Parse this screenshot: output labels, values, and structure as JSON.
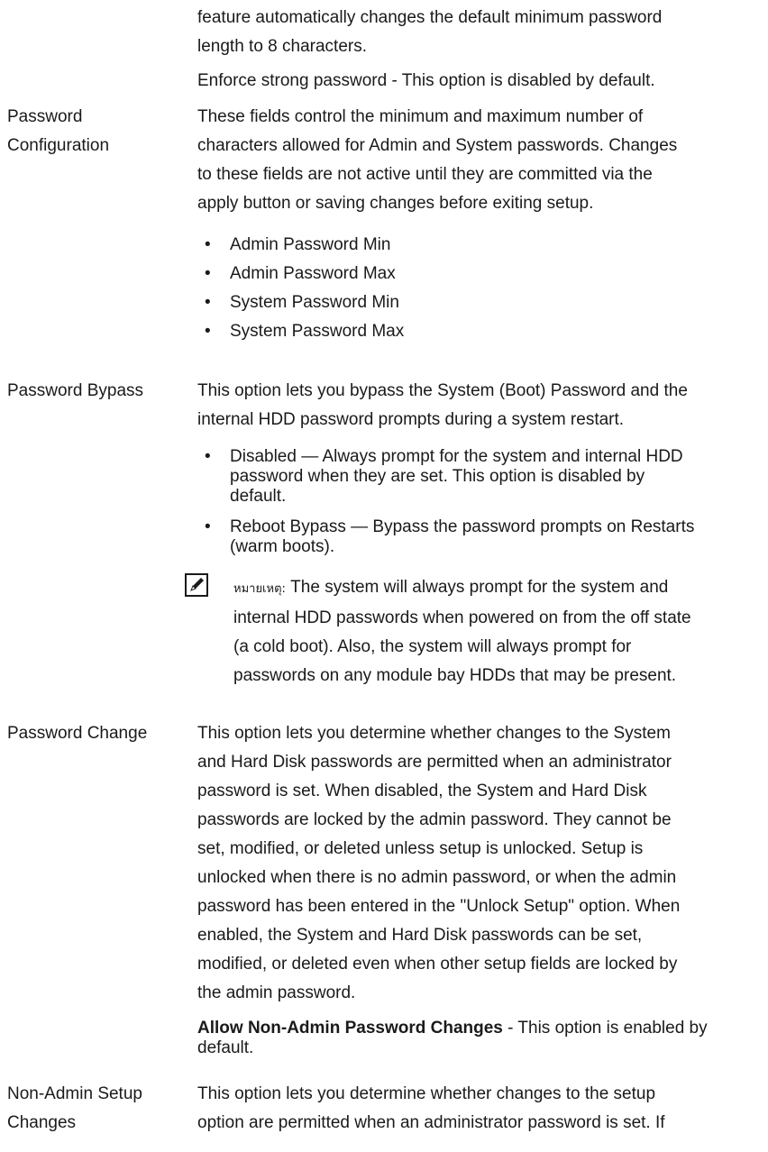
{
  "intro": {
    "lines": [
      "feature automatically changes the default minimum password",
      "length to 8 characters."
    ],
    "enforce": "Enforce strong password - This option is disabled by default."
  },
  "password_configuration": {
    "label_lines": [
      "Password",
      "Configuration"
    ],
    "desc_lines": [
      "These fields control the minimum and maximum number of",
      "characters allowed for Admin and System passwords. Changes",
      "to these fields are not active until they are committed via the",
      "apply button or saving changes before exiting setup."
    ],
    "items": [
      "Admin Password Min",
      "Admin Password Max",
      "System Password Min",
      "System Password Max"
    ]
  },
  "password_bypass": {
    "label": "Password Bypass",
    "desc_lines": [
      "This option lets you bypass the System (Boot) Password and the",
      "internal HDD password prompts during a system restart."
    ],
    "items": [
      {
        "lines": [
          "Disabled — Always prompt for the system and internal HDD",
          "password when they are set. This option is disabled by",
          "default."
        ]
      },
      {
        "lines": [
          "Reboot Bypass — Bypass the password prompts on Restarts",
          "(warm boots)."
        ]
      }
    ],
    "note": {
      "label": "หมายเหตุ:",
      "first_line": " The system will always prompt for the system and",
      "lines": [
        "internal HDD passwords when powered on from the off state",
        "(a cold boot). Also, the system will always prompt for",
        "passwords on any module bay HDDs that may be present."
      ]
    }
  },
  "password_change": {
    "label": "Password Change",
    "desc_lines": [
      "This option lets you determine whether changes to the System",
      "and Hard Disk passwords are permitted when an administrator",
      "password is set. When disabled, the System and Hard Disk",
      "passwords are locked by the admin password. They cannot be",
      "set, modified, or deleted unless setup is unlocked. Setup is",
      "unlocked when there is no admin password, or when the admin",
      "password has been entered in the \"Unlock Setup\" option. When",
      "enabled, the System and Hard Disk passwords can be set,",
      "modified, or deleted even when other setup fields are locked by",
      "the admin password."
    ],
    "setting_bold": "Allow Non-Admin Password Changes",
    "setting_rest": " - This option is enabled by",
    "setting_line2": "default."
  },
  "non_admin_setup": {
    "label_lines": [
      "Non-Admin Setup",
      "Changes"
    ],
    "desc_lines": [
      "This option lets you determine whether changes to the setup",
      "option are permitted when an administrator password is set. If"
    ]
  }
}
